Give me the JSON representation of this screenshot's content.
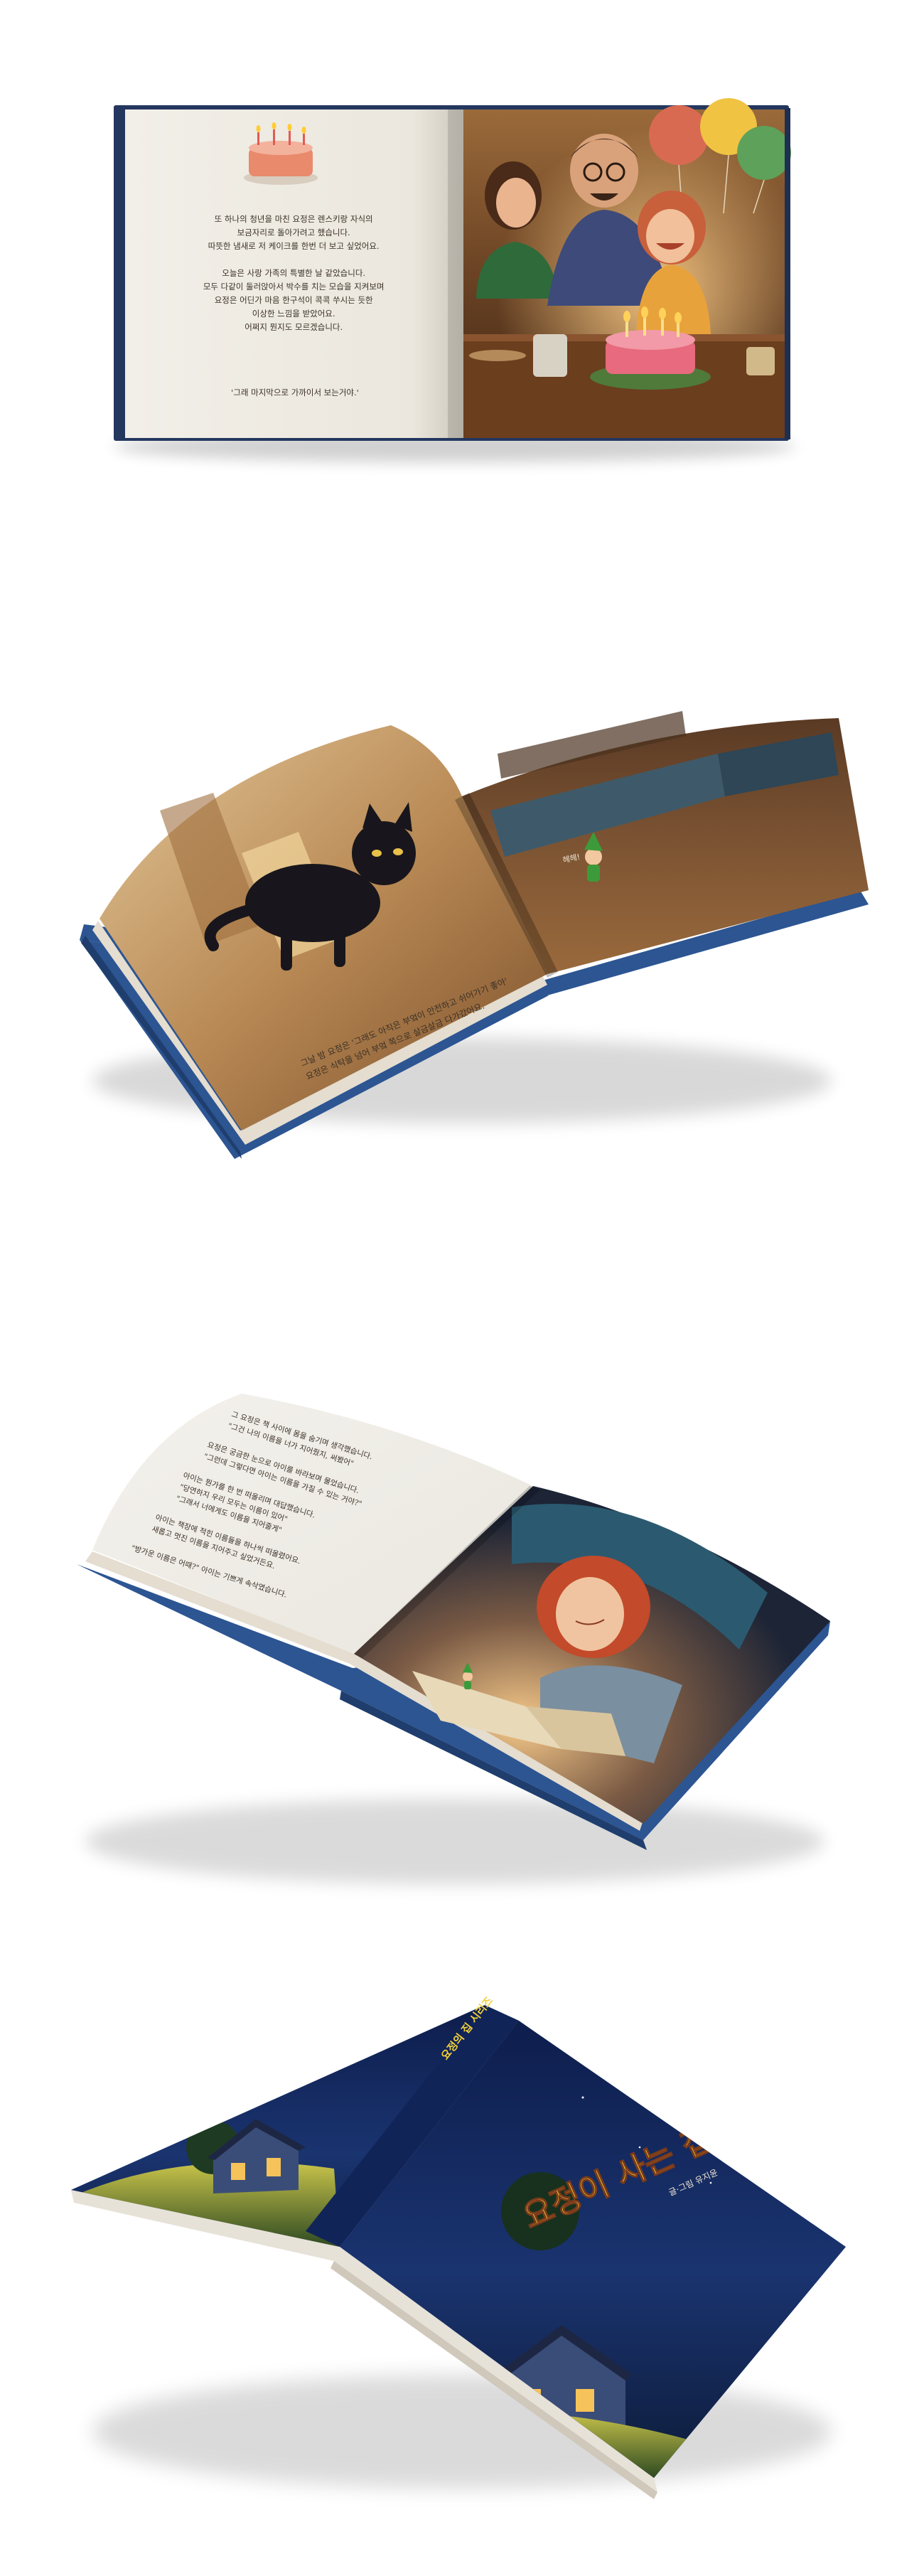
{
  "mockup_1": {
    "left_page_lines": [
      "또 하나의 청년을 마친 요정은 렌스키랑 자식의",
      "보금자리로 돌아가려고 했습니다.",
      "따뜻한 냄새로 저 케이크를 한번 더 보고 싶었어요.",
      "",
      "오늘은 사랑 가족의 특별한 날 같았습니다.",
      "모두 다같이 둘러앉아서 박수를 치는 모습을 지켜보며",
      "요정은 어딘가 마음 한구석이 콕콕 쑤시는 듯한",
      "이상한 느낌을 받았어요.",
      "어쩌지 뭔지도 모르겠습니다.",
      "",
      "'그래 마지막으로 가까이서 보는거야.'"
    ]
  },
  "mockup_2": {
    "page_lines": [
      "그날 밤 요정은 '그래도 아직은 부엌이 안전하고 쉬어가기 좋아'",
      "요정은 식탁을 넘어 부엌 쪽으로 살금살금 다가갔어요."
    ],
    "speech": "헤헤!"
  },
  "mockup_3": {
    "page_lines": [
      "그 요정은 책 사이에 몸을 숨기며 생각했습니다.",
      "\"그건 나의 이름을 너가 지어줬지, 써봤어\"",
      "",
      "요정은 궁금한 눈으로 아이를 바라보며 물었습니다.",
      "\"그런데 그렇다면 아이는 이름을 가질 수 있는 거야?\"",
      "",
      "아이는 뭔가를 한 번 떠올리며 대답했습니다.",
      "\"당연하지 우리 모두는 이름이 있어\"",
      "\"그래서 너에게도 이름을 지어줄게\"",
      "",
      "아이는 책장에 적힌 이름들을 하나씩 떠올렸어요.",
      "새롭고 멋진 이름을 지어주고 싶었거든요.",
      "",
      "\"방가운 이름은 어때?\" 아이는 기쁘게 속삭였습니다."
    ]
  },
  "mockup_4": {
    "series_label": "요정의 집 시리즈",
    "title": "요정이 사는 집",
    "author_line": "글·그림 유지윤"
  },
  "colors": {
    "background": "#ffffff",
    "cover_blue": "#2f5a93",
    "night_sky": "#13265a",
    "title_yellow": "#f2cf3a"
  }
}
